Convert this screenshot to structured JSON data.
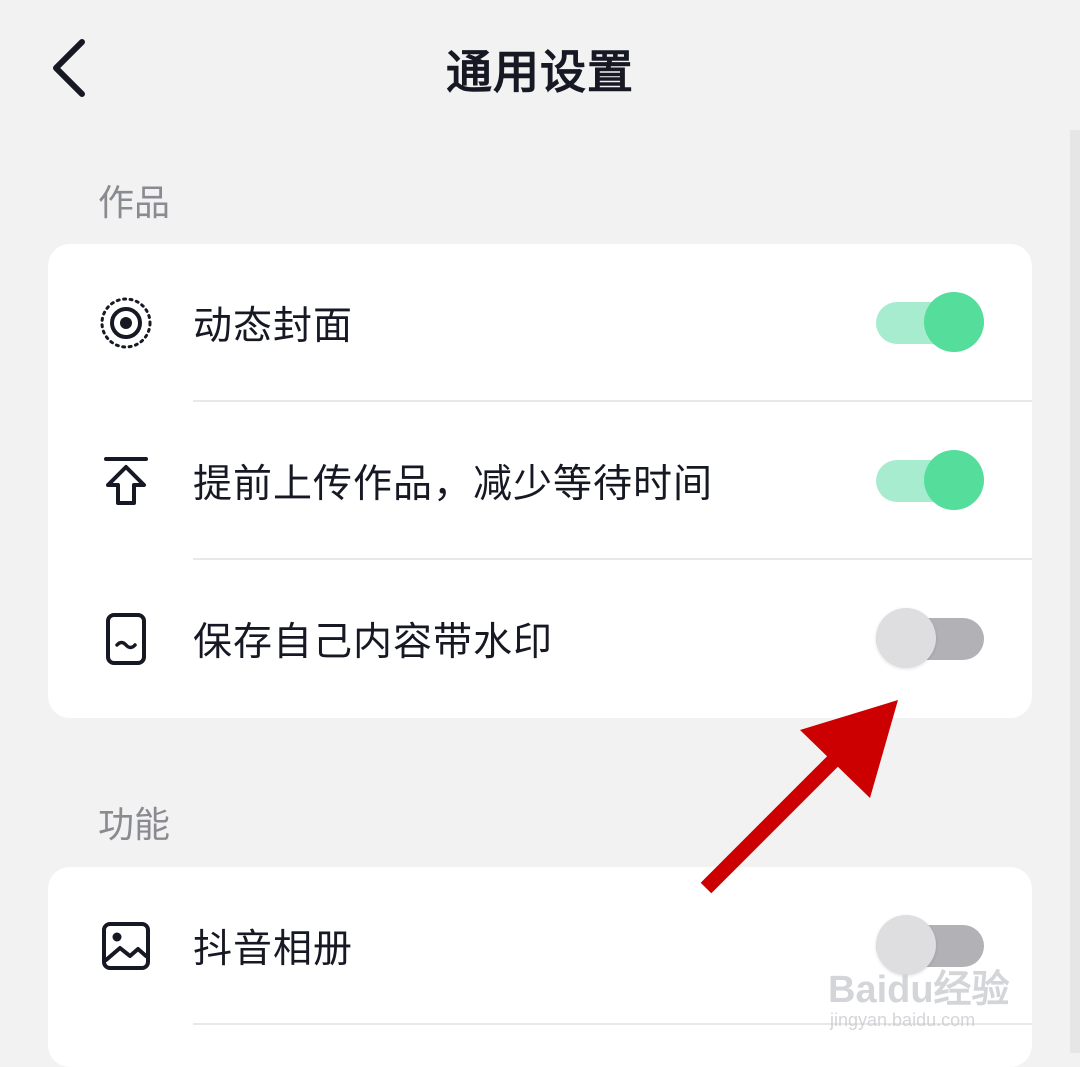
{
  "header": {
    "title": "通用设置",
    "back_icon": "chevron-left-icon"
  },
  "sections": [
    {
      "label": "作品",
      "items": [
        {
          "icon": "live-cover-icon",
          "label": "动态封面",
          "toggle_on": true
        },
        {
          "icon": "upload-icon",
          "label": "提前上传作品，减少等待时间",
          "toggle_on": true
        },
        {
          "icon": "watermark-phone-icon",
          "label": "保存自己内容带水印",
          "toggle_on": false
        }
      ]
    },
    {
      "label": "功能",
      "items": [
        {
          "icon": "photo-album-icon",
          "label": "抖音相册",
          "toggle_on": false
        }
      ]
    }
  ],
  "colors": {
    "toggle_on_track": "#a8ecd0",
    "toggle_on_knob": "#54dd9b",
    "toggle_off_track": "#b2b2b6",
    "toggle_off_knob": "#dedee0",
    "annotation_arrow": "#cc0000",
    "background": "#f2f2f2"
  },
  "watermark": {
    "brand": "Baidu经验",
    "url": "jingyan.baidu.com"
  }
}
